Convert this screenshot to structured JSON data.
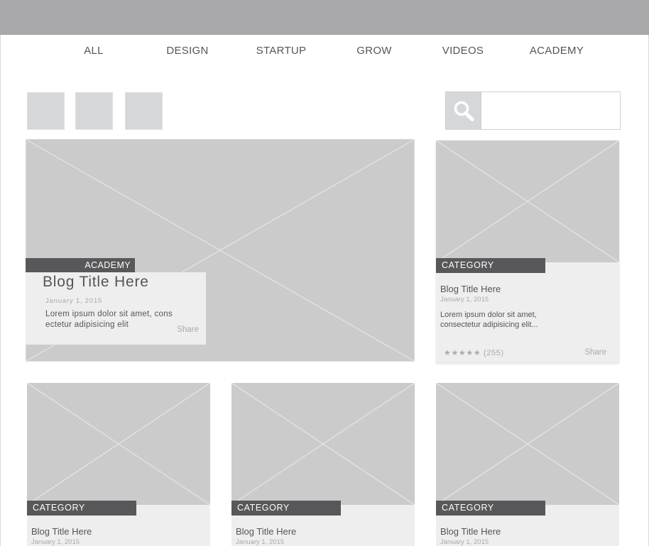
{
  "nav": {
    "items": [
      "ALL",
      "DESIGN",
      "STARTUP",
      "GROW",
      "VIDEOS",
      "ACADEMY"
    ]
  },
  "search": {
    "icon": "search-icon",
    "placeholder": ""
  },
  "hero": {
    "category": "ACADEMY",
    "title": "Blog Title Here",
    "date": "January 1, 2015",
    "excerpt": "Lorem ipsum dolor sit amet, cons ectetur adipisicing elit",
    "share": "Share"
  },
  "side_card": {
    "category": "CATEGORY",
    "title": "Blog Title Here",
    "date": "January 1, 2015",
    "excerpt": "Lorem ipsum dolor sit amet, consectetur adipisicing elit...",
    "rating": "★★★★★ (255)",
    "share": "Share"
  },
  "grid_cards": [
    {
      "category": "CATEGORY",
      "title": "Blog Title Here",
      "date": "January 1, 2015"
    },
    {
      "category": "CATEGORY",
      "title": "Blog Title Here",
      "date": "January 1, 2015"
    },
    {
      "category": "CATEGORY",
      "title": "Blog Title Here",
      "date": "January 1, 2015"
    }
  ],
  "colors": {
    "topbar": "#a9a9ab",
    "placeholder": "#cbcbcb",
    "tag": "#58585a",
    "card": "#eeeeee"
  }
}
